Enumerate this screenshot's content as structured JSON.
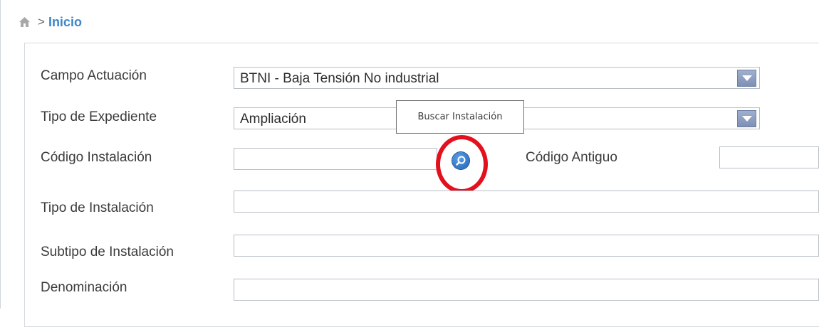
{
  "breadcrumb": {
    "home_icon": "home-icon",
    "separator": ">",
    "current": "Inicio"
  },
  "form": {
    "campo_actuacion": {
      "label": "Campo Actuación",
      "value": "BTNI - Baja Tensión No industrial",
      "arrow_icon": "dropdown-arrow-icon"
    },
    "tipo_expediente": {
      "label": "Tipo de Expediente",
      "value": "Ampliación",
      "arrow_icon": "dropdown-arrow-icon"
    },
    "codigo_instalacion": {
      "label": "Código Instalación",
      "value": "",
      "search_icon": "search-icon"
    },
    "codigo_antiguo": {
      "label": "Código Antiguo",
      "value": ""
    },
    "tipo_instalacion": {
      "label": "Tipo de Instalación",
      "value": ""
    },
    "subtipo_instalacion": {
      "label": "Subtipo de Instalación",
      "value": ""
    },
    "denominacion": {
      "label": "Denominación",
      "value": ""
    }
  },
  "tooltip": {
    "text": "Buscar Instalación"
  },
  "colors": {
    "breadcrumb_active": "#3c86c9",
    "annotation_circle": "#e3101e",
    "dropdown_arrow": "#8a9bc0"
  }
}
